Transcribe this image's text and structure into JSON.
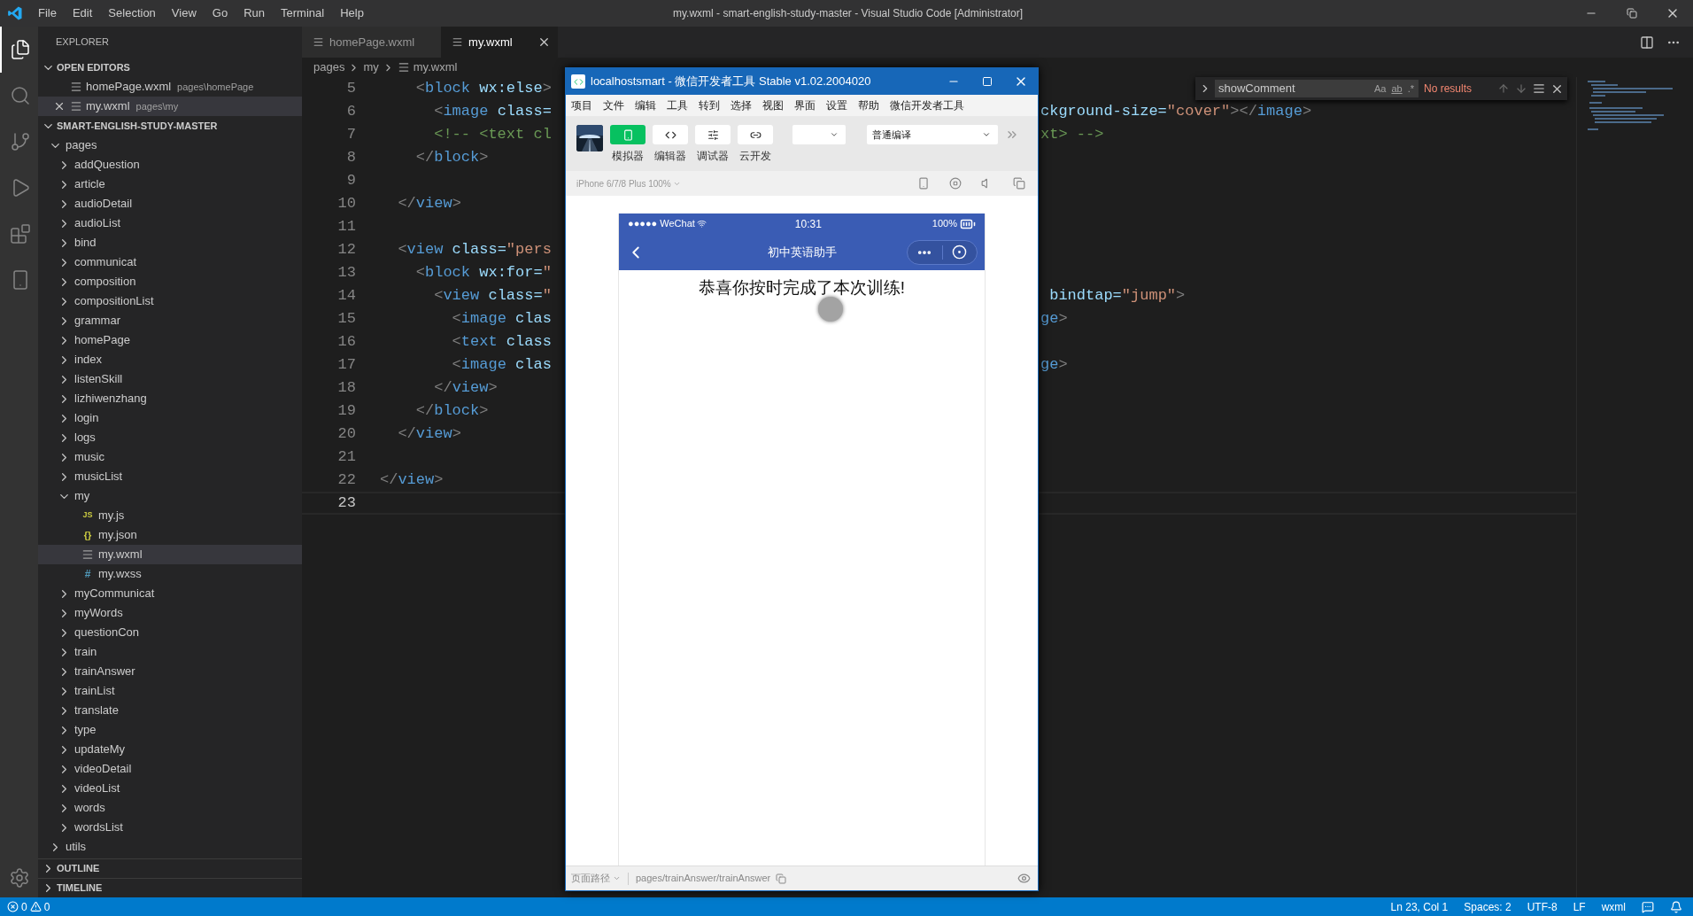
{
  "title_bar": {
    "menu": [
      "File",
      "Edit",
      "Selection",
      "View",
      "Go",
      "Run",
      "Terminal",
      "Help"
    ],
    "title": "my.wxml - smart-english-study-master - Visual Studio Code [Administrator]"
  },
  "activity_bar": {
    "items": [
      {
        "kind": "files",
        "selected": true
      },
      {
        "kind": "search",
        "selected": false
      },
      {
        "kind": "scm",
        "selected": false
      },
      {
        "kind": "debug",
        "selected": false
      },
      {
        "kind": "extensions",
        "selected": false
      },
      {
        "kind": "device",
        "selected": false
      }
    ]
  },
  "sidebar": {
    "title": "EXPLORER",
    "open_editors": {
      "title": "OPEN EDITORS",
      "expanded": true,
      "items": [
        {
          "name": "homePage.wxml",
          "path": "pages\\homePage",
          "selected": false
        },
        {
          "name": "my.wxml",
          "path": "pages\\my",
          "selected": true
        }
      ]
    },
    "project": {
      "title": "SMART-ENGLISH-STUDY-MASTER",
      "expanded": true,
      "tree": [
        {
          "label": "pages",
          "kind": "folder",
          "expanded": true,
          "selected": false,
          "children": [
            {
              "label": "addQuestion",
              "kind": "folder",
              "expanded": false,
              "selected": false
            },
            {
              "label": "article",
              "kind": "folder",
              "expanded": false,
              "selected": false
            },
            {
              "label": "audioDetail",
              "kind": "folder",
              "expanded": false,
              "selected": false
            },
            {
              "label": "audioList",
              "kind": "folder",
              "expanded": false,
              "selected": false
            },
            {
              "label": "bind",
              "kind": "folder",
              "expanded": false,
              "selected": false
            },
            {
              "label": "communicat",
              "kind": "folder",
              "expanded": false,
              "selected": false
            },
            {
              "label": "composition",
              "kind": "folder",
              "expanded": false,
              "selected": false
            },
            {
              "label": "compositionList",
              "kind": "folder",
              "expanded": false,
              "selected": false
            },
            {
              "label": "grammar",
              "kind": "folder",
              "expanded": false,
              "selected": false
            },
            {
              "label": "homePage",
              "kind": "folder",
              "expanded": false,
              "selected": false
            },
            {
              "label": "index",
              "kind": "folder",
              "expanded": false,
              "selected": false
            },
            {
              "label": "listenSkill",
              "kind": "folder",
              "expanded": false,
              "selected": false
            },
            {
              "label": "lizhiwenzhang",
              "kind": "folder",
              "expanded": false,
              "selected": false
            },
            {
              "label": "login",
              "kind": "folder",
              "expanded": false,
              "selected": false
            },
            {
              "label": "logs",
              "kind": "folder",
              "expanded": false,
              "selected": false
            },
            {
              "label": "music",
              "kind": "folder",
              "expanded": false,
              "selected": false
            },
            {
              "label": "musicList",
              "kind": "folder",
              "expanded": false,
              "selected": false
            },
            {
              "label": "my",
              "kind": "folder",
              "expanded": true,
              "selected": false,
              "children": [
                {
                  "label": "my.js",
                  "kind": "js",
                  "glyph": "JS",
                  "selected": false
                },
                {
                  "label": "my.json",
                  "kind": "json",
                  "glyph": "{}",
                  "selected": false
                },
                {
                  "label": "my.wxml",
                  "kind": "wxml",
                  "selected": true
                },
                {
                  "label": "my.wxss",
                  "kind": "wxss",
                  "glyph": "#",
                  "selected": false
                }
              ]
            },
            {
              "label": "myCommunicat",
              "kind": "folder",
              "expanded": false,
              "selected": false
            },
            {
              "label": "myWords",
              "kind": "folder",
              "expanded": false,
              "selected": false
            },
            {
              "label": "questionCon",
              "kind": "folder",
              "expanded": false,
              "selected": false
            },
            {
              "label": "train",
              "kind": "folder",
              "expanded": false,
              "selected": false
            },
            {
              "label": "trainAnswer",
              "kind": "folder",
              "expanded": false,
              "selected": false
            },
            {
              "label": "trainList",
              "kind": "folder",
              "expanded": false,
              "selected": false
            },
            {
              "label": "translate",
              "kind": "folder",
              "expanded": false,
              "selected": false
            },
            {
              "label": "type",
              "kind": "folder",
              "expanded": false,
              "selected": false
            },
            {
              "label": "updateMy",
              "kind": "folder",
              "expanded": false,
              "selected": false
            },
            {
              "label": "videoDetail",
              "kind": "folder",
              "expanded": false,
              "selected": false
            },
            {
              "label": "videoList",
              "kind": "folder",
              "expanded": false,
              "selected": false
            },
            {
              "label": "words",
              "kind": "folder",
              "expanded": false,
              "selected": false
            },
            {
              "label": "wordsList",
              "kind": "folder",
              "expanded": false,
              "selected": false
            }
          ]
        },
        {
          "label": "utils",
          "kind": "folder",
          "expanded": false,
          "selected": false
        }
      ]
    },
    "outline": {
      "title": "OUTLINE",
      "expanded": false
    },
    "timeline": {
      "title": "TIMELINE",
      "expanded": false
    }
  },
  "editor": {
    "tabs": [
      {
        "label": "homePage.wxml",
        "selected": false
      },
      {
        "label": "my.wxml",
        "selected": true
      }
    ],
    "breadcrumbs": [
      "pages",
      "my",
      "my.wxml"
    ],
    "lines": [
      {
        "number": "5",
        "current": false,
        "left": [
          {
            "kind": "punct",
            "text": "    <"
          },
          {
            "kind": "tag",
            "text": "block"
          },
          {
            "kind": "attr",
            "text": " wx:else"
          },
          {
            "kind": "punct",
            "text": ">"
          }
        ]
      },
      {
        "number": "6",
        "current": false,
        "left": [
          {
            "kind": "punct",
            "text": "      <"
          },
          {
            "kind": "tag",
            "text": "image"
          },
          {
            "kind": "attr",
            "text": " class="
          }
        ],
        "right": [
          {
            "kind": "attr",
            "text": "ckground-size="
          },
          {
            "kind": "string",
            "text": "\"cover\""
          },
          {
            "kind": "punct",
            "text": "></"
          },
          {
            "kind": "tag",
            "text": "image"
          },
          {
            "kind": "punct",
            "text": ">"
          }
        ]
      },
      {
        "number": "7",
        "current": false,
        "left": [
          {
            "kind": "comment",
            "text": "      <!-- <text cl"
          }
        ],
        "right": [
          {
            "kind": "comment",
            "text": "xt> -->"
          }
        ]
      },
      {
        "number": "8",
        "current": false,
        "left": [
          {
            "kind": "punct",
            "text": "    </"
          },
          {
            "kind": "tag",
            "text": "block"
          },
          {
            "kind": "punct",
            "text": ">"
          }
        ]
      },
      {
        "number": "9",
        "current": false
      },
      {
        "number": "10",
        "current": false,
        "left": [
          {
            "kind": "punct",
            "text": "  </"
          },
          {
            "kind": "tag",
            "text": "view"
          },
          {
            "kind": "punct",
            "text": ">"
          }
        ]
      },
      {
        "number": "11",
        "current": false
      },
      {
        "number": "12",
        "current": false,
        "left": [
          {
            "kind": "punct",
            "text": "  <"
          },
          {
            "kind": "tag",
            "text": "view"
          },
          {
            "kind": "attr",
            "text": " class="
          },
          {
            "kind": "string",
            "text": "\"pers"
          }
        ]
      },
      {
        "number": "13",
        "current": false,
        "left": [
          {
            "kind": "punct",
            "text": "    <"
          },
          {
            "kind": "tag",
            "text": "block"
          },
          {
            "kind": "attr",
            "text": " wx:for="
          },
          {
            "kind": "string",
            "text": "\""
          }
        ]
      },
      {
        "number": "14",
        "current": false,
        "left": [
          {
            "kind": "punct",
            "text": "      <"
          },
          {
            "kind": "tag",
            "text": "view"
          },
          {
            "kind": "attr",
            "text": " class="
          },
          {
            "kind": "string",
            "text": "\""
          }
        ],
        "right": [
          {
            "kind": "attr",
            "text": " bindtap="
          },
          {
            "kind": "string",
            "text": "\"jump\""
          },
          {
            "kind": "punct",
            "text": ">"
          }
        ]
      },
      {
        "number": "15",
        "current": false,
        "left": [
          {
            "kind": "punct",
            "text": "        <"
          },
          {
            "kind": "tag",
            "text": "image"
          },
          {
            "kind": "attr",
            "text": " clas"
          }
        ],
        "right": [
          {
            "kind": "tag",
            "text": "ge"
          },
          {
            "kind": "punct",
            "text": ">"
          }
        ]
      },
      {
        "number": "16",
        "current": false,
        "left": [
          {
            "kind": "punct",
            "text": "        <"
          },
          {
            "kind": "tag",
            "text": "text"
          },
          {
            "kind": "attr",
            "text": " class"
          }
        ]
      },
      {
        "number": "17",
        "current": false,
        "left": [
          {
            "kind": "punct",
            "text": "        <"
          },
          {
            "kind": "tag",
            "text": "image"
          },
          {
            "kind": "attr",
            "text": " clas"
          }
        ],
        "right": [
          {
            "kind": "tag",
            "text": "ge"
          },
          {
            "kind": "punct",
            "text": ">"
          }
        ]
      },
      {
        "number": "18",
        "current": false,
        "left": [
          {
            "kind": "punct",
            "text": "      </"
          },
          {
            "kind": "tag",
            "text": "view"
          },
          {
            "kind": "punct",
            "text": ">"
          }
        ]
      },
      {
        "number": "19",
        "current": false,
        "left": [
          {
            "kind": "punct",
            "text": "    </"
          },
          {
            "kind": "tag",
            "text": "block"
          },
          {
            "kind": "punct",
            "text": ">"
          }
        ]
      },
      {
        "number": "20",
        "current": false,
        "left": [
          {
            "kind": "punct",
            "text": "  </"
          },
          {
            "kind": "tag",
            "text": "view"
          },
          {
            "kind": "punct",
            "text": ">"
          }
        ]
      },
      {
        "number": "21",
        "current": false
      },
      {
        "number": "22",
        "current": false,
        "left": [
          {
            "kind": "punct",
            "text": "</"
          },
          {
            "kind": "tag",
            "text": "view"
          },
          {
            "kind": "punct",
            "text": ">"
          }
        ]
      },
      {
        "number": "23",
        "current": true
      }
    ],
    "find": {
      "value": "showComment",
      "options": [
        "Aa",
        "ab",
        ".*"
      ],
      "result": "No results"
    }
  },
  "devtools": {
    "title": "localhostsmart - 微信开发者工具 Stable v1.02.2004020",
    "menu": [
      "项目",
      "文件",
      "编辑",
      "工具",
      "转到",
      "选择",
      "视图",
      "界面",
      "设置",
      "帮助",
      "微信开发者工具"
    ],
    "tools": [
      {
        "label": "模拟器",
        "kind": "simulator",
        "selected": true
      },
      {
        "label": "编辑器",
        "kind": "editor",
        "selected": false
      },
      {
        "label": "调试器",
        "kind": "debugger",
        "selected": false
      },
      {
        "label": "云开发",
        "kind": "cloud",
        "selected": false
      }
    ],
    "compile_mode": "普通编译",
    "device": "iPhone 6/7/8 Plus 100%",
    "phone": {
      "carrier": "●●●●● WeChat",
      "time": "10:31",
      "battery": "100%",
      "title": "初中英语助手",
      "message": "恭喜你按时完成了本次训练!"
    },
    "page_path_label": "页面路径",
    "page_path": "pages/trainAnswer/trainAnswer"
  },
  "status_bar": {
    "errors": "0",
    "warnings": "0",
    "items": [
      "Ln 23, Col 1",
      "Spaces: 2",
      "UTF-8",
      "LF",
      "wxml"
    ]
  }
}
